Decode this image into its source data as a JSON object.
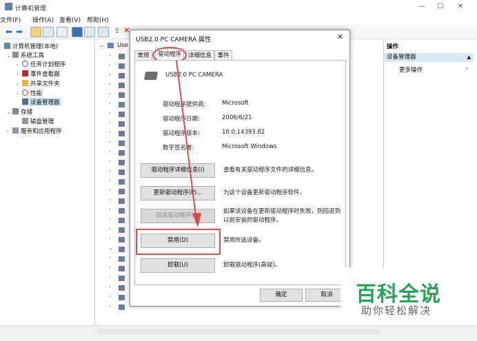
{
  "window": {
    "title": "计算机管理",
    "menu": [
      "文件(F)",
      "操作(A)",
      "查看(V)",
      "帮助(H)"
    ],
    "min_icon": "minimize-icon",
    "max_icon": "maximize-icon",
    "close_icon": "close-icon"
  },
  "tree": {
    "root": "计算机管理(本地)",
    "system_tools": "系统工具",
    "task_scheduler": "任务计划程序",
    "event_viewer": "事件查看器",
    "shared_folders": "共享文件夹",
    "performance": "性能",
    "device_manager": "设备管理器",
    "storage": "存储",
    "disk_management": "磁盘管理",
    "services": "服务和应用程序"
  },
  "devices": {
    "root_label": "Use"
  },
  "actions": {
    "header": "操作",
    "section": "设备管理器",
    "more": "更多操作"
  },
  "dialog": {
    "title": "USB2.0 PC CAMERA 属性",
    "tabs": [
      "常规",
      "驱动程序",
      "详细信息",
      "事件"
    ],
    "device_name": "USB2.0 PC CAMERA",
    "fields": [
      {
        "label": "驱动程序提供商:",
        "value": "Microsoft"
      },
      {
        "label": "驱动程序日期:",
        "value": "2006/6/21"
      },
      {
        "label": "驱动程序版本:",
        "value": "10.0.14393.82"
      },
      {
        "label": "数字签名者:",
        "value": "Microsoft Windows"
      }
    ],
    "buttons": {
      "details": "驱动程序详细信息(I)",
      "update": "更新驱动程序(P)...",
      "rollback": "回退驱动程序(R)",
      "disable": "禁用(D)",
      "uninstall": "卸载(U)"
    },
    "descriptions": {
      "details": "查看有关驱动程序文件的详细信息。",
      "update": "为这个设备更新驱动程序软件。",
      "rollback_1": "如果该设备在更新驱动程序时失败，则回退到",
      "rollback_2": "以前安装的驱动程序。",
      "disable": "禁用所选设备。",
      "uninstall": "卸载驱动程序(高级)。"
    },
    "ok": "确定",
    "cancel": "取消"
  },
  "watermark": {
    "main": "百科全说",
    "sub": "助你轻松解决"
  },
  "colors": {
    "highlight": "#e04848",
    "selection": "#cce4f7",
    "watermark_green": "#27a25a"
  }
}
